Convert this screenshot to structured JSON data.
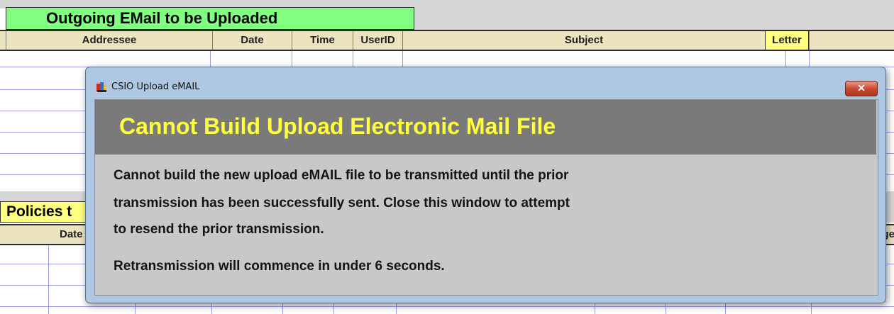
{
  "background": {
    "top_section_title": "Outgoing EMail to be Uploaded",
    "top_columns": [
      {
        "label": "Addressee",
        "highlight": false
      },
      {
        "label": "Date",
        "highlight": false
      },
      {
        "label": "Time",
        "highlight": false
      },
      {
        "label": "UserID",
        "highlight": false
      },
      {
        "label": "Subject",
        "highlight": false
      },
      {
        "label": "Letter",
        "highlight": true
      }
    ],
    "bottom_section_title": "Policies t",
    "bottom_columns": {
      "left": "Date",
      "right": "ange"
    }
  },
  "dialog": {
    "title": "CSIO Upload eMAIL",
    "close_label": "✕",
    "heading": "Cannot Build Upload Electronic Mail File",
    "message_lines": [
      "Cannot build the new upload eMAIL file to be transmitted until the prior",
      "transmission has been successfully sent.   Close this window to attempt",
      "to resend the prior transmission."
    ],
    "countdown": "Retransmission will commence in under 6 seconds."
  },
  "colors": {
    "section_green": "#80ff80",
    "section_yellow": "#ffff80",
    "header_tan": "#ece3bf",
    "grid_line": "#9d9de3",
    "banner_gray": "#7a7a7a",
    "banner_text": "#ffff40",
    "close_red": "#c8452e"
  }
}
